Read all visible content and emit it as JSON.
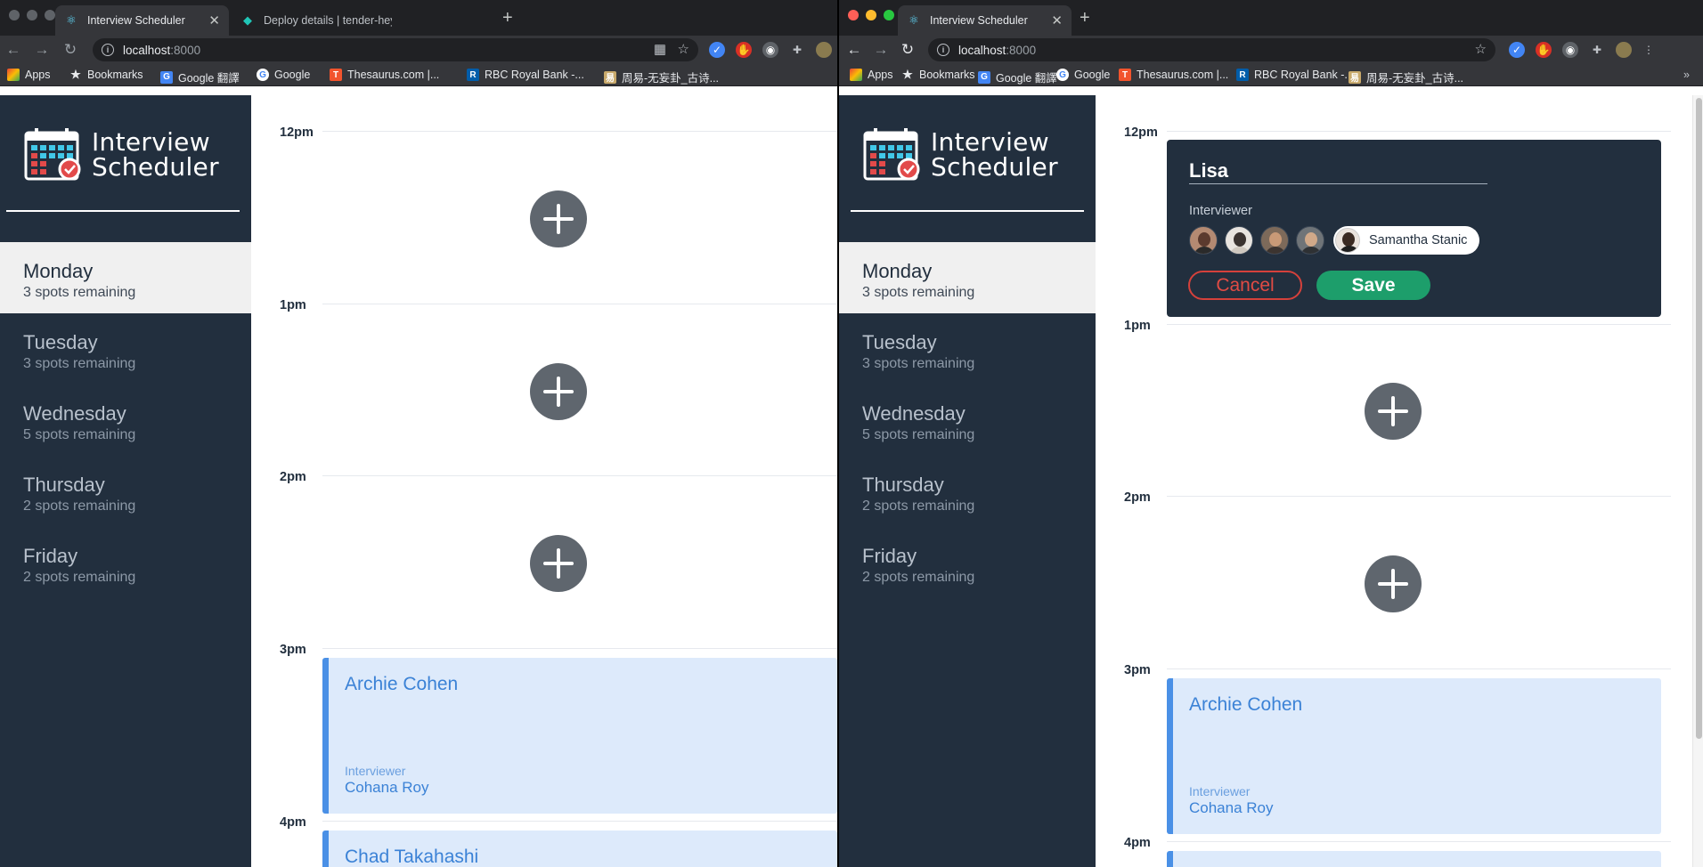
{
  "colors": {
    "sidebar_bg": "#222f3e",
    "selected_day_bg": "#f0f0f0",
    "appointment_bg": "#ddeafb",
    "appointment_accent": "#4a90e6",
    "cancel_red": "#e14b44",
    "save_green": "#1d9e6b",
    "add_button": "#5f666e"
  },
  "left_window": {
    "tabs": [
      {
        "title": "Interview Scheduler",
        "icon": "react-icon"
      },
      {
        "title": "Deploy details | tender-heyrov",
        "icon": "netlify-icon"
      }
    ],
    "url_host": "localhost",
    "url_port": ":8000"
  },
  "right_window": {
    "tabs": [
      {
        "title": "Interview Scheduler",
        "icon": "react-icon"
      }
    ],
    "url_host": "localhost",
    "url_port": ":8000"
  },
  "bookmarks": [
    "Apps",
    "Bookmarks",
    "Google 翻譯",
    "Google",
    "Thesaurus.com |...",
    "RBC Royal Bank -...",
    "周易-无妄卦_古诗..."
  ],
  "brand": {
    "line1": "Interview",
    "line2": "Scheduler"
  },
  "days": [
    {
      "name": "Monday",
      "spots": "3 spots remaining",
      "selected": true
    },
    {
      "name": "Tuesday",
      "spots": "3 spots remaining"
    },
    {
      "name": "Wednesday",
      "spots": "5 spots remaining"
    },
    {
      "name": "Thursday",
      "spots": "2 spots remaining"
    },
    {
      "name": "Friday",
      "spots": "2 spots remaining"
    }
  ],
  "hours": [
    "12pm",
    "1pm",
    "2pm",
    "3pm",
    "4pm"
  ],
  "appointments": [
    {
      "student": "Archie Cohen",
      "interviewer_label": "Interviewer",
      "interviewer": "Cohana Roy"
    },
    {
      "student": "Chad Takahashi"
    }
  ],
  "form": {
    "student_value": "Lisa",
    "interviewer_label": "Interviewer",
    "selected_interviewer": "Samantha Stanic",
    "cancel_label": "Cancel",
    "save_label": "Save"
  }
}
